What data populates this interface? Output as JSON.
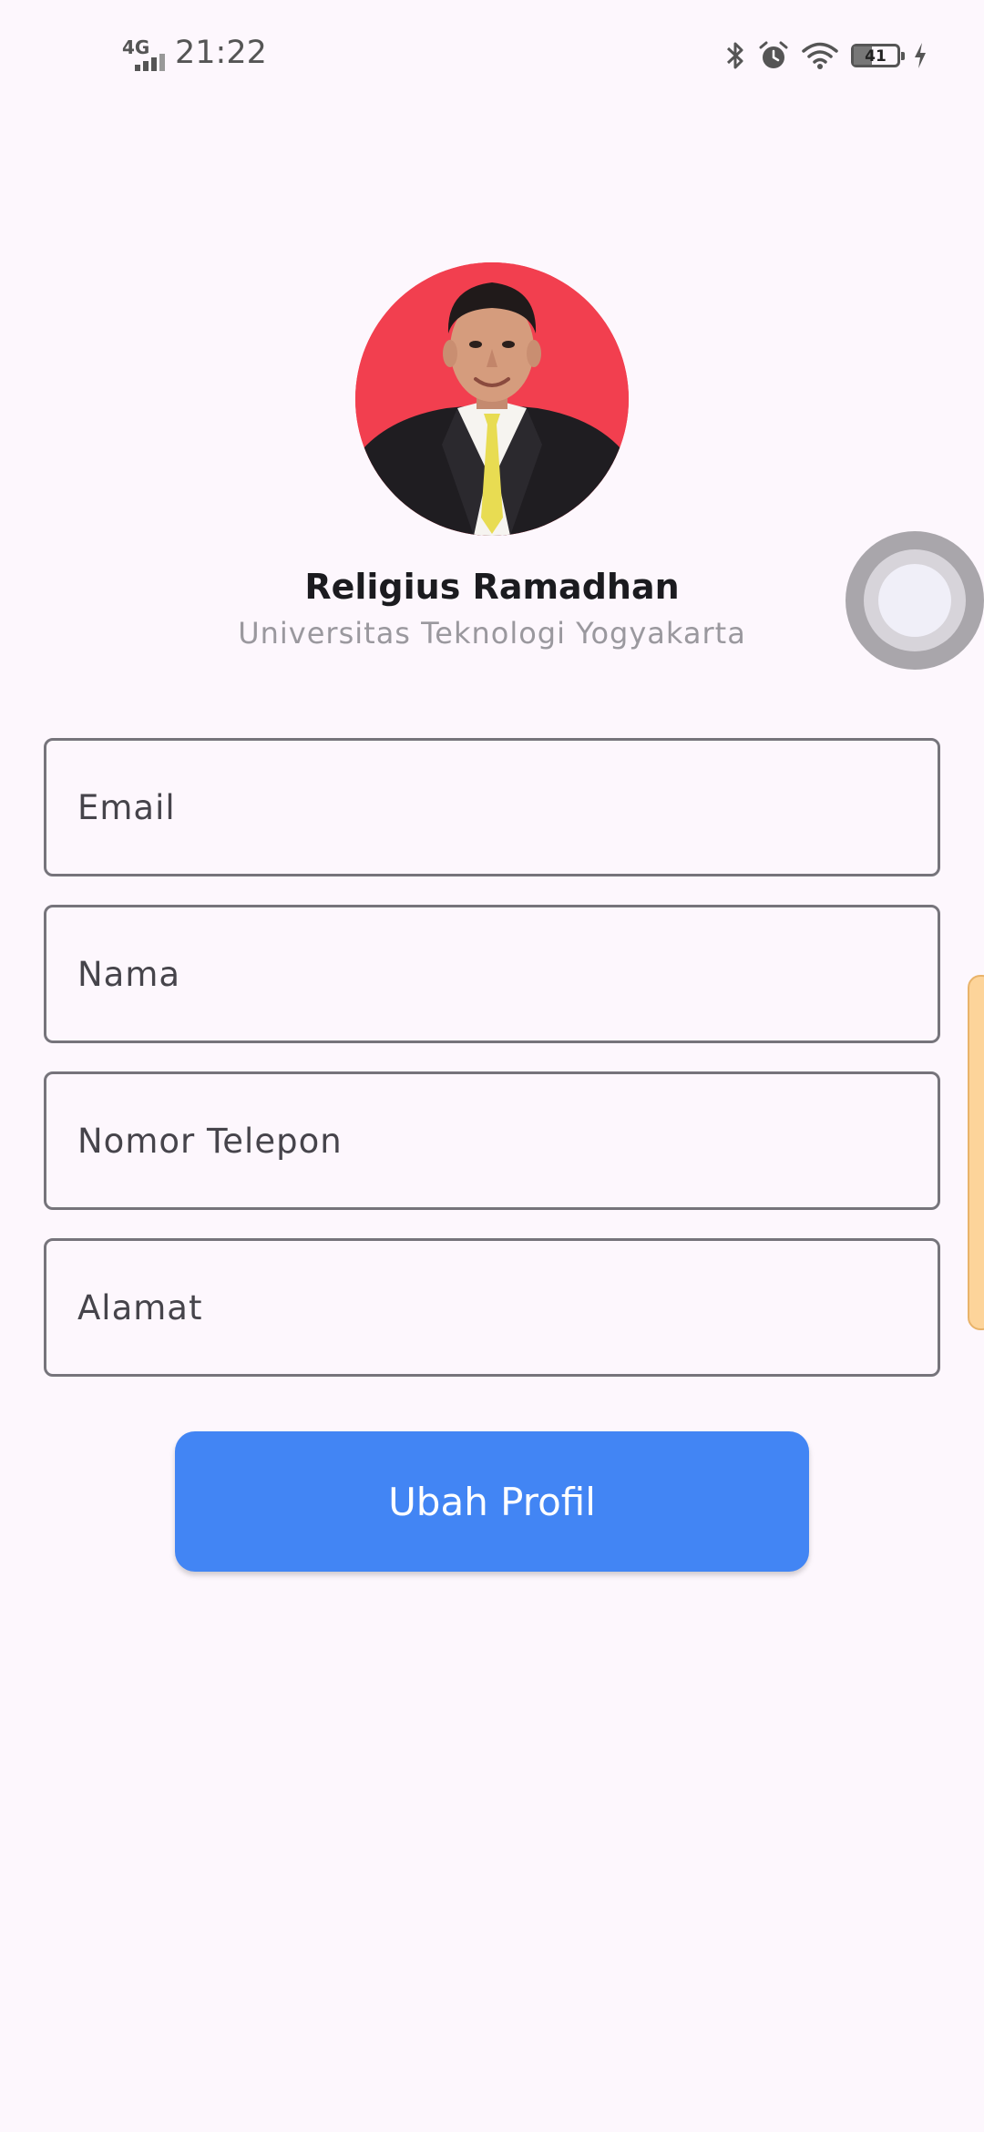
{
  "status_bar": {
    "network_type": "4G",
    "time": "21:22",
    "battery_level": "41",
    "battery_fraction": 0.41,
    "icons": [
      "signal-icon",
      "bluetooth-icon",
      "alarm-icon",
      "wifi-icon",
      "battery-icon",
      "charging-icon"
    ]
  },
  "profile": {
    "name": "Religius Ramadhan",
    "university": "Universitas Teknologi Yogyakarta",
    "avatar_background": "#f23f4f"
  },
  "form": {
    "email_placeholder": "Email",
    "name_placeholder": "Nama",
    "phone_placeholder": "Nomor Telepon",
    "address_placeholder": "Alamat",
    "submit_label": "Ubah Profil"
  },
  "colors": {
    "background": "#fdf7fd",
    "button": "#4285f4",
    "field_border": "#76747b",
    "edge_tab": "#fdd49a"
  }
}
